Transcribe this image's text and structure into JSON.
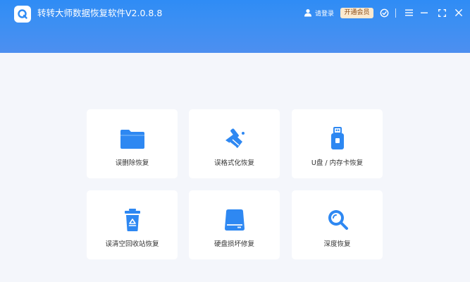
{
  "header": {
    "title": "转转大师数据恢复软件V2.0.8.8",
    "login_label": "请登录",
    "vip_label": "开通会员"
  },
  "icons": {
    "logo": "app-logo-icon",
    "user": "user-icon",
    "support": "headset-icon",
    "menu": "menu-icon",
    "minimize": "minimize-icon",
    "fullscreen": "fullscreen-icon",
    "close": "close-icon"
  },
  "colors": {
    "brand": "#2f8cf5",
    "icon_blue": "#2e88f2",
    "vip_bg": "#fbe9cf",
    "vip_text": "#8a4b14"
  },
  "cards": [
    {
      "label": "误删除恢复",
      "icon": "folder-icon"
    },
    {
      "label": "误格式化恢复",
      "icon": "broom-icon"
    },
    {
      "label": "U盘 / 内存卡恢复",
      "icon": "usb-drive-icon"
    },
    {
      "label": "误清空回收站恢复",
      "icon": "recycle-bin-icon"
    },
    {
      "label": "硬盘损坏修复",
      "icon": "hard-disk-icon"
    },
    {
      "label": "深度恢复",
      "icon": "magnifier-icon"
    }
  ]
}
